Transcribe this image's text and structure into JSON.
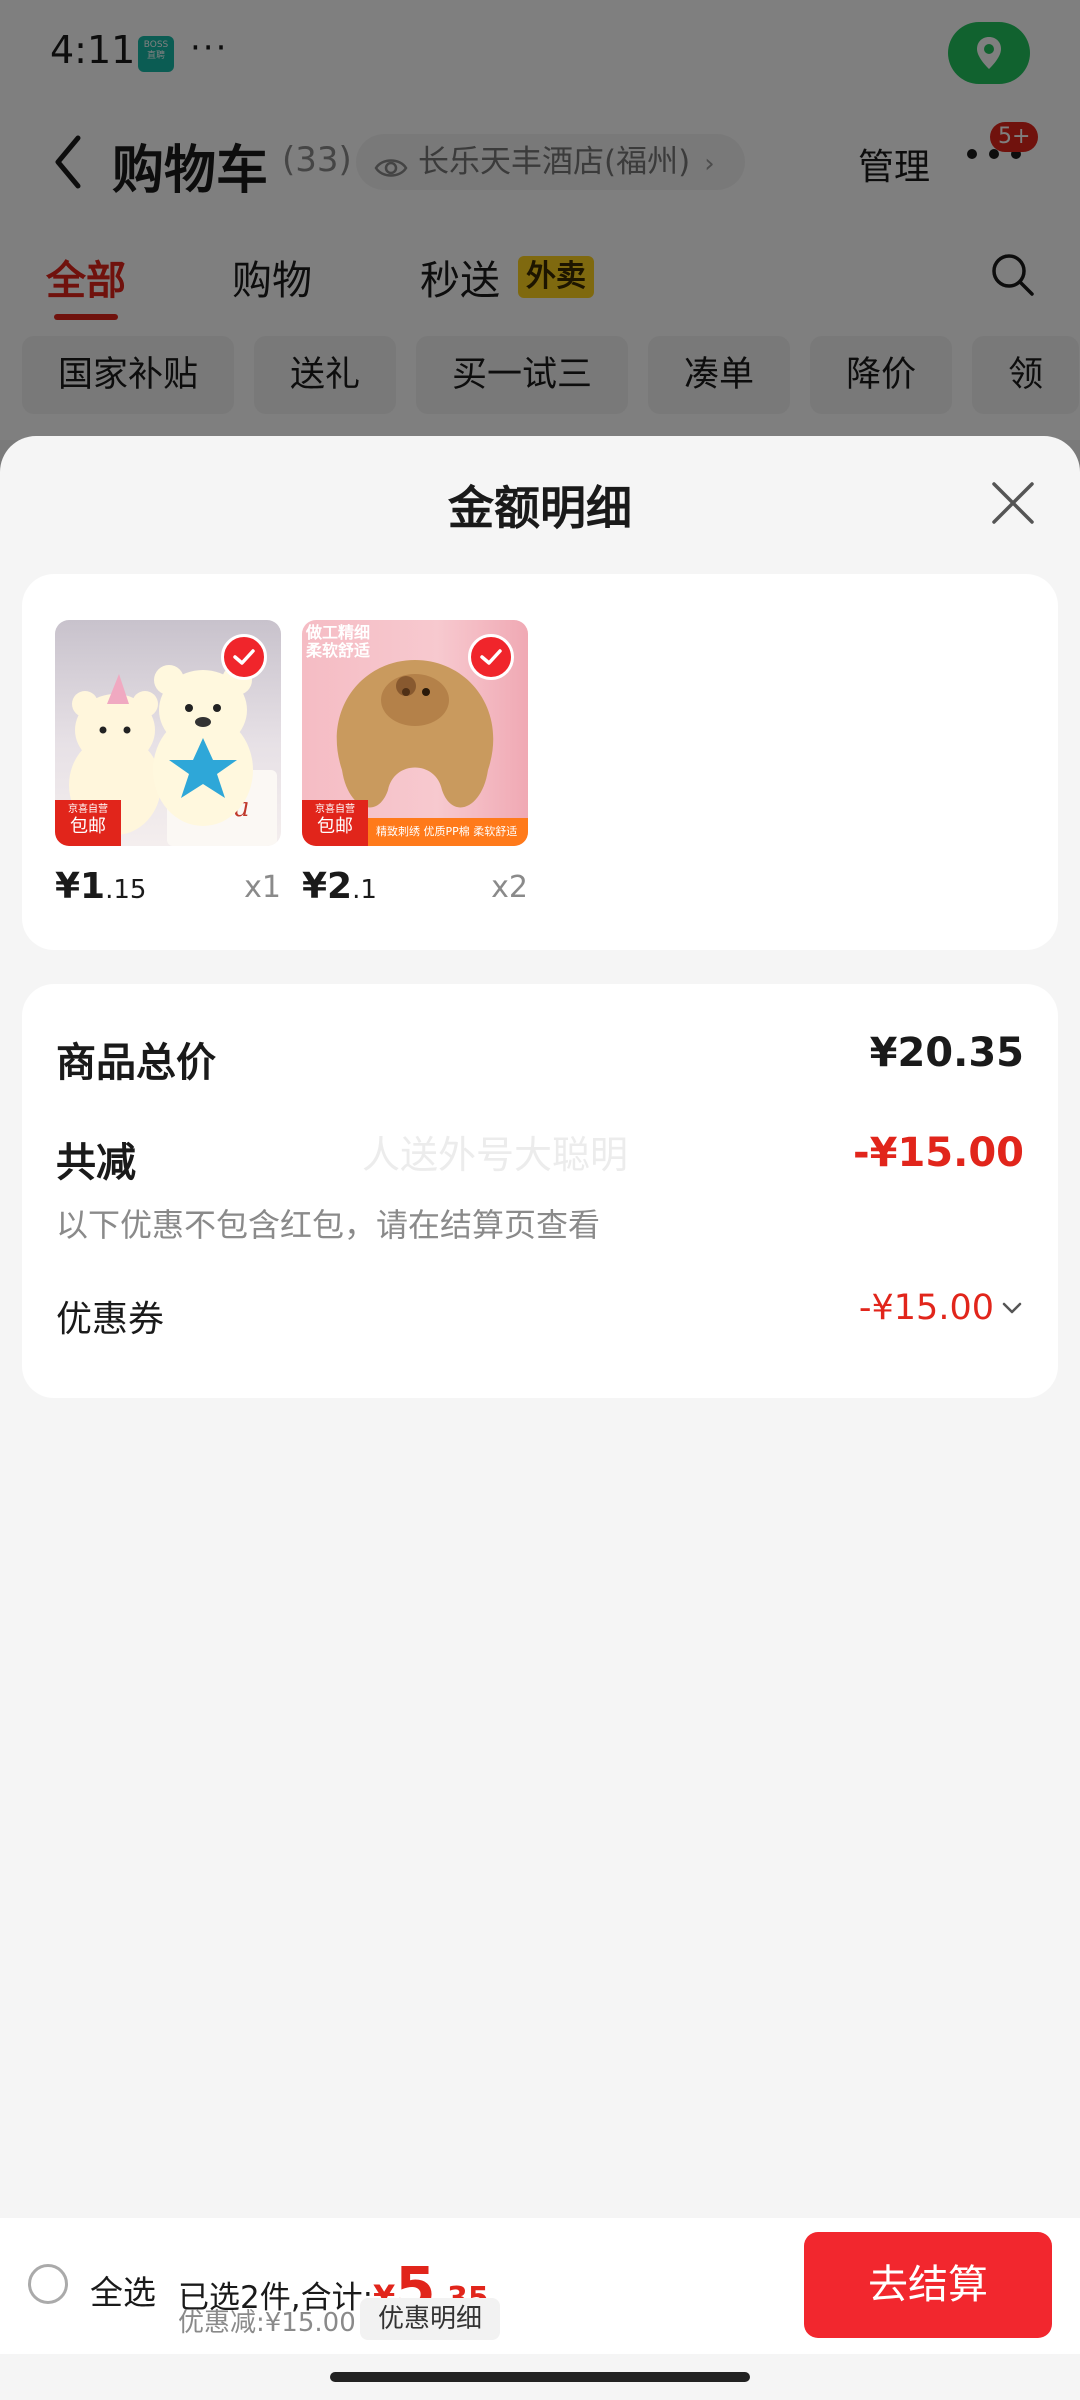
{
  "status_bar": {
    "time": "4:11",
    "app_badge": "BOSS 直聘",
    "more": "···"
  },
  "header": {
    "title": "购物车",
    "count": "(33)",
    "address": "长乐天丰酒店(福州)",
    "manage": "管理",
    "badge": "5+"
  },
  "tabs": [
    {
      "label": "全部"
    },
    {
      "label": "购物"
    },
    {
      "label": "秒送"
    }
  ],
  "tab_tag": "外卖",
  "chips": [
    "国家补贴",
    "送礼",
    "买一试三",
    "凑单",
    "降价",
    "领"
  ],
  "sheet": {
    "title": "金额明细",
    "products": [
      {
        "thumb_brand": "京喜自营",
        "thumb_tag": "包邮",
        "price_int": "¥1",
        "price_dec": ".15",
        "qty": "x1",
        "thumb_caption": "",
        "thumb_strip": ""
      },
      {
        "thumb_brand": "京喜自营",
        "thumb_tag": "包邮",
        "price_int": "¥2",
        "price_dec": ".1",
        "qty": "x2",
        "thumb_caption": "做工精细 柔软舒适",
        "thumb_strip": "精致刺绣 优质PP棉 柔软舒适"
      }
    ],
    "summary": {
      "total_label": "商品总价",
      "total_value": "¥20.35",
      "discount_label": "共减",
      "discount_value": "-¥15.00",
      "note": "以下优惠不包含红包，请在结算页查看",
      "watermark": "人送外号大聪明",
      "coupon_label": "优惠券",
      "coupon_value": "-¥15.00"
    }
  },
  "bottom_bar": {
    "select_all": "全选",
    "selected_text": "已选2件,合计:",
    "total_symbol": "¥",
    "total_int": "5",
    "total_dec": ".35",
    "discount_text": "优惠减:¥15.00",
    "detail_button": "优惠明细",
    "checkout": "去结算"
  },
  "colors": {
    "accent": "#e1251b",
    "checkout": "#f2272e",
    "location_pill": "#22c55e",
    "waimai_tag": "#ffd21f"
  },
  "icons": [
    "location-pin-icon",
    "back-arrow-icon",
    "eye-icon",
    "more-dots-icon",
    "search-icon",
    "close-icon",
    "check-icon",
    "chevron-down-icon"
  ]
}
